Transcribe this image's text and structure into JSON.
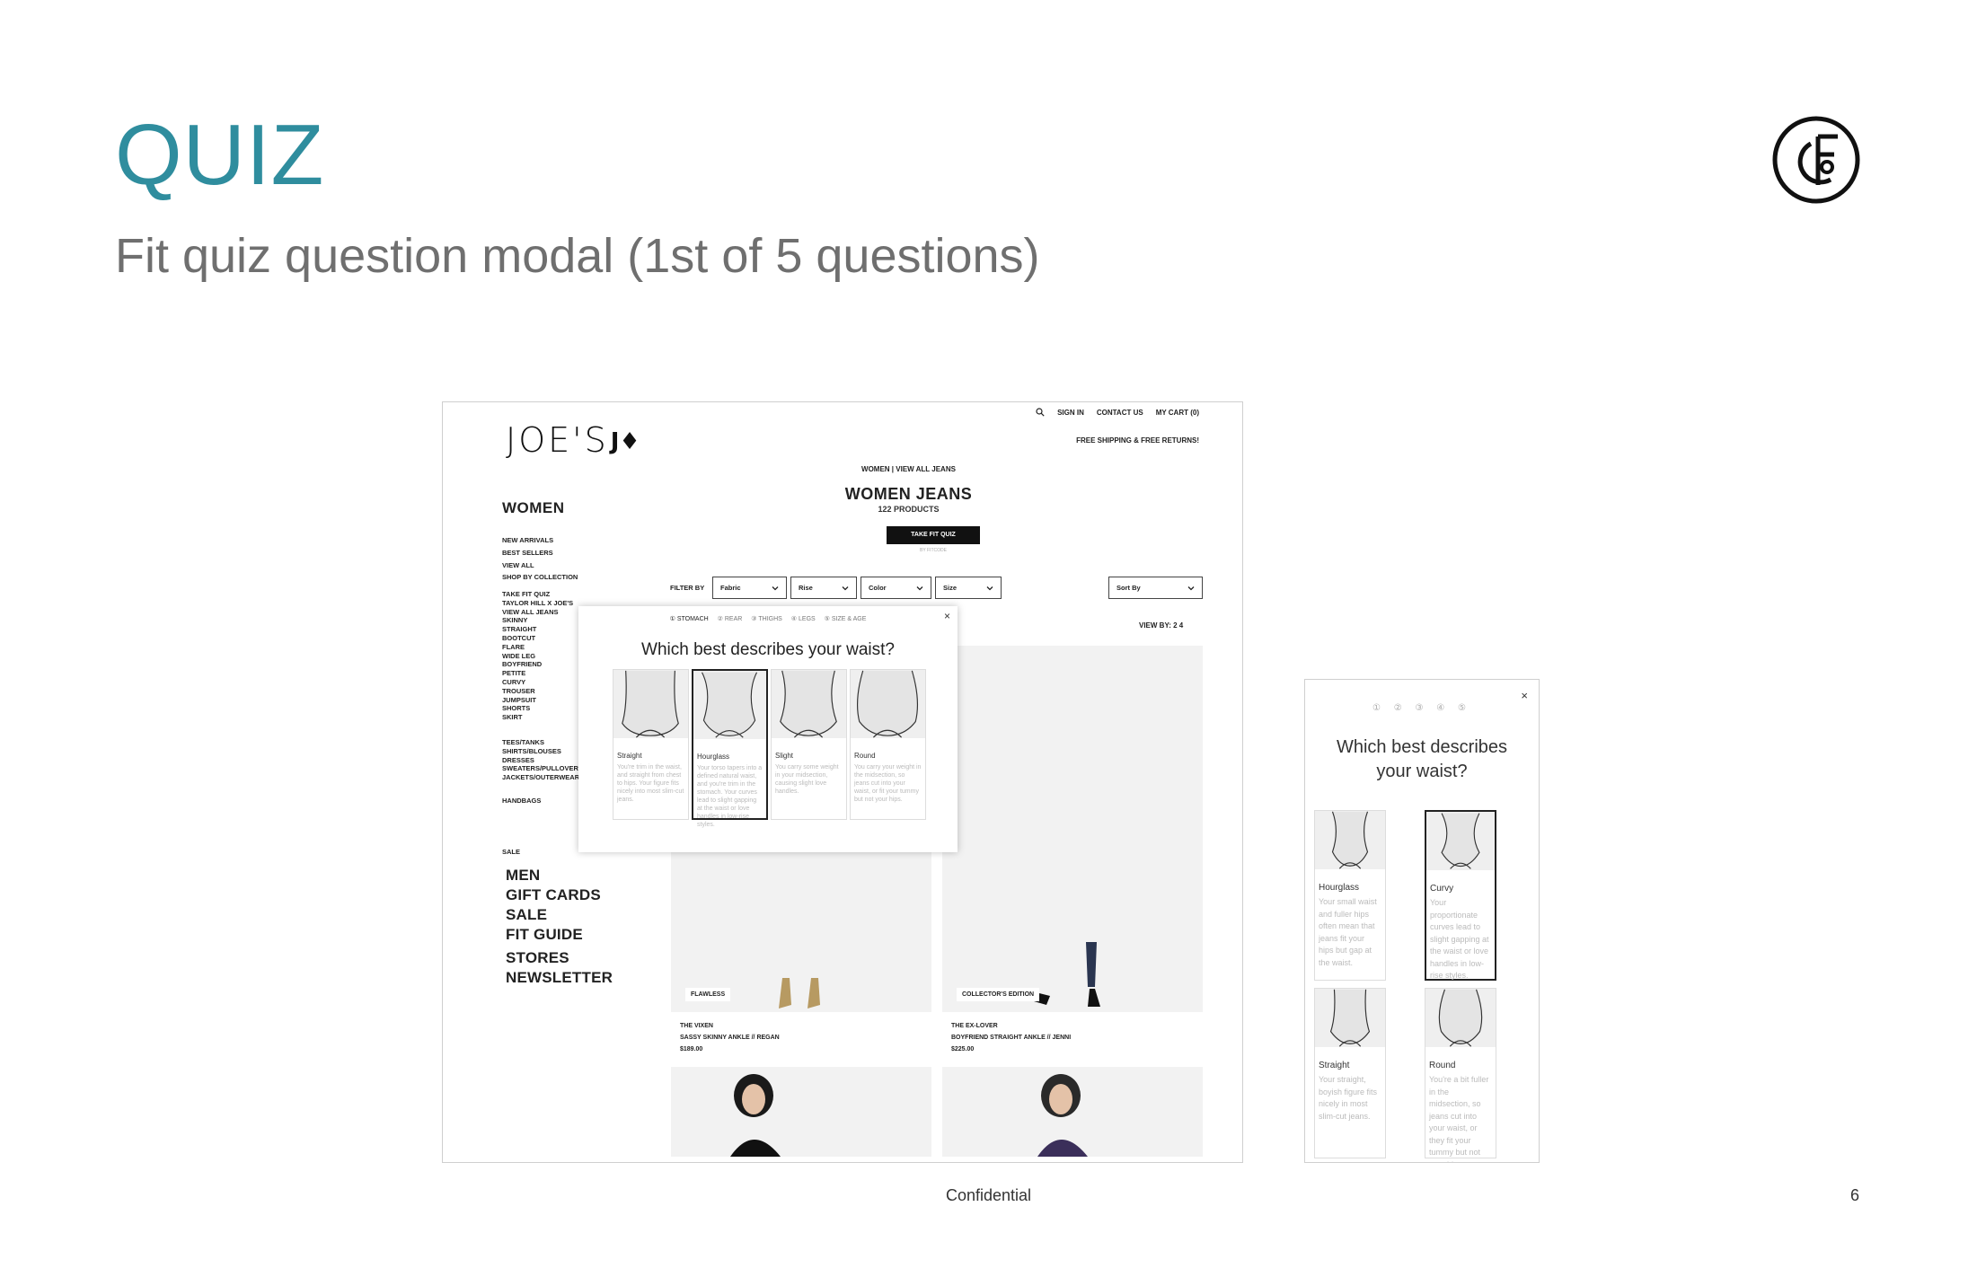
{
  "slide": {
    "title": "QUIZ",
    "subtitle": "Fit quiz question modal (1st of 5 questions)",
    "footer": "Confidential",
    "page_number": "6",
    "title_color": "#2f8d9e"
  },
  "desktop": {
    "brand": "JOE'S",
    "top_links": {
      "sign_in": "SIGN IN",
      "contact": "CONTACT US",
      "cart": "MY CART (0)"
    },
    "free_shipping": "FREE SHIPPING & FREE RETURNS!",
    "breadcrumb": "WOMEN  |  VIEW ALL JEANS",
    "page_title": "WOMEN JEANS",
    "product_count": "122 PRODUCTS",
    "quiz_button": "TAKE FIT QUIZ",
    "by_fitcode": "BY FITCODE",
    "sidebar": {
      "heading": "WOMEN",
      "group1": [
        "NEW ARRIVALS",
        "BEST SELLERS",
        "VIEW ALL"
      ],
      "collection": "SHOP BY COLLECTION",
      "group2": [
        "TAKE FIT QUIZ",
        "TAYLOR HILL X JOE'S",
        "VIEW ALL JEANS",
        "SKINNY",
        "STRAIGHT",
        "BOOTCUT",
        "FLARE",
        "WIDE LEG",
        "BOYFRIEND",
        "PETITE",
        "CURVY",
        "TROUSER",
        "JUMPSUIT",
        "SHORTS",
        "SKIRT"
      ],
      "group3": [
        "TEES/TANKS",
        "SHIRTS/BLOUSES",
        "DRESSES",
        "SWEATERS/PULLOVERS",
        "JACKETS/OUTERWEAR"
      ],
      "handbags": "HANDBAGS",
      "sale_small": "SALE",
      "big_links": [
        "MEN",
        "GIFT CARDS",
        "SALE",
        "FIT GUIDE"
      ],
      "big_links2": [
        "STORES",
        "NEWSLETTER"
      ]
    },
    "filters": {
      "label": "FILTER BY",
      "options": [
        "Fabric",
        "Rise",
        "Color",
        "Size"
      ],
      "sort": "Sort By"
    },
    "view_by": "VIEW BY:  2   4",
    "products": [
      {
        "tag": "FLAWLESS",
        "line1": "THE VIXEN",
        "line2": "SASSY SKINNY ANKLE // REGAN",
        "price": "$189.00"
      },
      {
        "tag": "COLLECTOR'S EDITION",
        "line1": "THE EX-LOVER",
        "line2": "BOYFRIEND STRAIGHT ANKLE // JENNI",
        "price": "$225.00"
      }
    ],
    "modal": {
      "steps": [
        "① STOMACH",
        "② REAR",
        "③ THIGHS",
        "④ LEGS",
        "⑤ SIZE & AGE"
      ],
      "close": "×",
      "question": "Which best describes your waist?",
      "options": [
        {
          "label": "Straight",
          "desc": "You're trim in the waist, and straight from chest to hips. Your figure fits nicely into most slim-cut jeans."
        },
        {
          "label": "Hourglass",
          "desc": "Your torso tapers into a defined natural waist, and you're trim in the stomach. Your curves lead to slight gapping at the waist or love handles in low-rise styles."
        },
        {
          "label": "Slight",
          "desc": "You carry some weight in your midsection, causing slight love handles."
        },
        {
          "label": "Round",
          "desc": "You carry your weight in the midsection, so jeans cut into your waist, or fit your tummy but not your hips."
        }
      ],
      "selected_index": 1
    }
  },
  "mobile": {
    "steps": "① ② ③ ④ ⑤",
    "close": "×",
    "question_line1": "Which best describes",
    "question_line2": "your waist?",
    "options": [
      {
        "label": "Hourglass",
        "desc": "Your small waist and fuller hips often mean that jeans fit your hips but gap at the waist."
      },
      {
        "label": "Curvy",
        "desc": "Your proportionate curves lead to slight gapping at the waist or love handles in low-rise styles."
      },
      {
        "label": "Straight",
        "desc": "Your straight, boyish figure fits nicely in most slim-cut jeans."
      },
      {
        "label": "Round",
        "desc": "You're a bit fuller in the midsection, so jeans cut into your waist, or they fit your tummy but not your hips."
      }
    ],
    "selected_index": 1
  }
}
